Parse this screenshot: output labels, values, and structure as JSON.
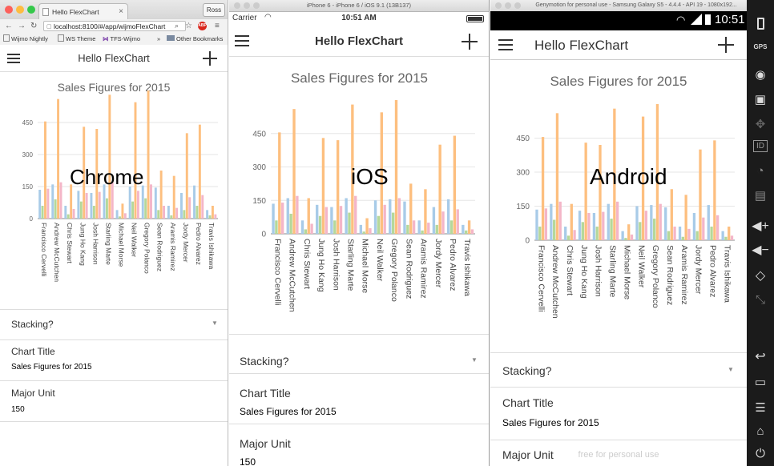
{
  "app": {
    "title": "Hello FlexChart",
    "chart_title": "Sales Figures for 2015",
    "settings": {
      "stacking_label": "Stacking?",
      "chart_title_label": "Chart Title",
      "chart_title_value": "Sales Figures for 2015",
      "major_unit_label": "Major Unit",
      "major_unit_value": "150"
    }
  },
  "chrome": {
    "watermark": "Chrome",
    "tab_title": "Hello FlexChart",
    "profile": "Ross",
    "url": "localhost:8100/#/app/wijmoFlexChart",
    "bookmarks": [
      "Wijmo Nightly",
      "WS Theme",
      "TFS-Wijmo",
      "»",
      "Other Bookmarks"
    ]
  },
  "ios": {
    "watermark": "iOS",
    "sim_title": "iPhone 6 - iPhone 6 / iOS 9.1 (13B137)",
    "carrier": "Carrier",
    "time": "10:51 AM"
  },
  "android": {
    "watermark": "Android",
    "window_title": "Genymotion for personal use - Samsung Galaxy S5 - 4.4.4 - API 19 - 1080x192...",
    "time": "10:51",
    "bottom_overlay": "free for personal use",
    "sidebar_icons": [
      "battery-icon",
      "gps-icon",
      "webcam-icon",
      "video-icon",
      "dpad-icon",
      "id-icon",
      "signal-icon",
      "sms-icon",
      "volume-up-icon",
      "volume-down-icon",
      "rotate-icon",
      "resize-icon",
      "back-icon",
      "recent-apps-icon",
      "menu-icon",
      "home-icon",
      "power-icon"
    ],
    "sidebar_labels": {
      "gps": "GPS",
      "id": "ID"
    }
  },
  "chart_data": {
    "type": "bar",
    "title": "Sales Figures for 2015",
    "categories": [
      "Francisco Cervelli",
      "Andrew McCutchen",
      "Chris Stewart",
      "Jung Ho Kang",
      "Josh Harrison",
      "Starling Marte",
      "Michael Morse",
      "Neil Walker",
      "Gregory Polanco",
      "Sean Rodriguez",
      "Aramis Ramirez",
      "Jordy Mercer",
      "Pedro Alvarez",
      "Travis Ishikawa"
    ],
    "series": [
      {
        "color": "#a8cbe8",
        "values": [
          135,
          160,
          60,
          130,
          120,
          160,
          40,
          150,
          155,
          145,
          60,
          120,
          155,
          40
        ]
      },
      {
        "color": "#b5d89a",
        "values": [
          60,
          90,
          20,
          80,
          60,
          95,
          10,
          80,
          95,
          40,
          15,
          40,
          60,
          15
        ]
      },
      {
        "color": "#fdbf7f",
        "values": [
          455,
          560,
          160,
          430,
          420,
          580,
          70,
          545,
          600,
          225,
          200,
          400,
          440,
          60
        ]
      },
      {
        "color": "#f4b6c8",
        "values": [
          140,
          170,
          45,
          120,
          125,
          170,
          25,
          130,
          160,
          60,
          50,
          100,
          110,
          20
        ]
      }
    ],
    "y_ticks": [
      "0",
      "150",
      "300",
      "450"
    ],
    "ylim": [
      0,
      600
    ],
    "major_unit": 150,
    "grid": true
  }
}
